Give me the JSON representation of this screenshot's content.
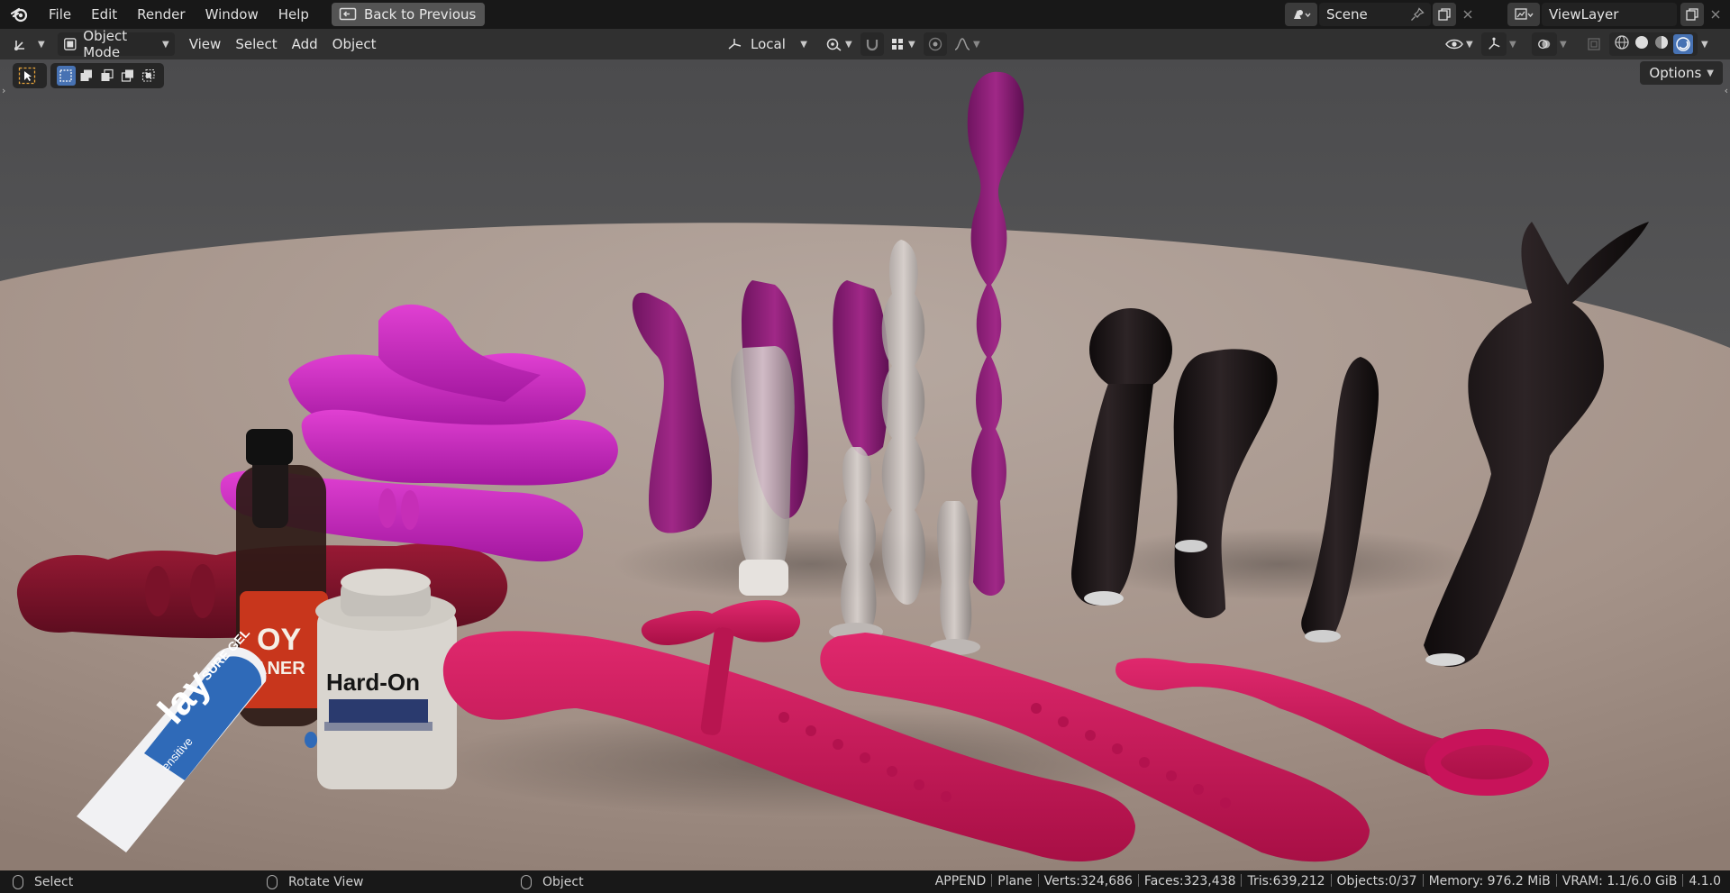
{
  "menu": {
    "items": [
      "File",
      "Edit",
      "Render",
      "Window",
      "Help"
    ],
    "back_button": "Back to Previous"
  },
  "scene": {
    "name": "Scene"
  },
  "view_layer": {
    "name": "ViewLayer"
  },
  "header": {
    "mode": "Object Mode",
    "menus": [
      "View",
      "Select",
      "Add",
      "Object"
    ],
    "transform_orientation": "Local"
  },
  "viewport": {
    "options_label": "Options",
    "objects": {
      "bottle_label_top": "OY",
      "bottle_label_bottom": "ANER",
      "jar_label": "Hard-On",
      "tube_label_top": "SURE GEL",
      "tube_label_big": "lay",
      "tube_label_small": "ensitive"
    }
  },
  "statusbar": {
    "hint_select": "Select",
    "hint_rotate": "Rotate View",
    "hint_object": "Object",
    "mode": "APPEND",
    "active": "Plane",
    "verts": "Verts:324,686",
    "faces": "Faces:323,438",
    "tris": "Tris:639,212",
    "objects": "Objects:0/37",
    "memory": "Memory: 976.2 MiB",
    "vram": "VRAM: 1.1/6.0 GiB",
    "version": "4.1.0"
  },
  "colors": {
    "accent": "#4772b3",
    "hot_pink": "#d0195c",
    "magenta": "#c21fb4",
    "purple": "#8a1a70",
    "black_toy": "#1c1416",
    "table": "#a8988f"
  }
}
